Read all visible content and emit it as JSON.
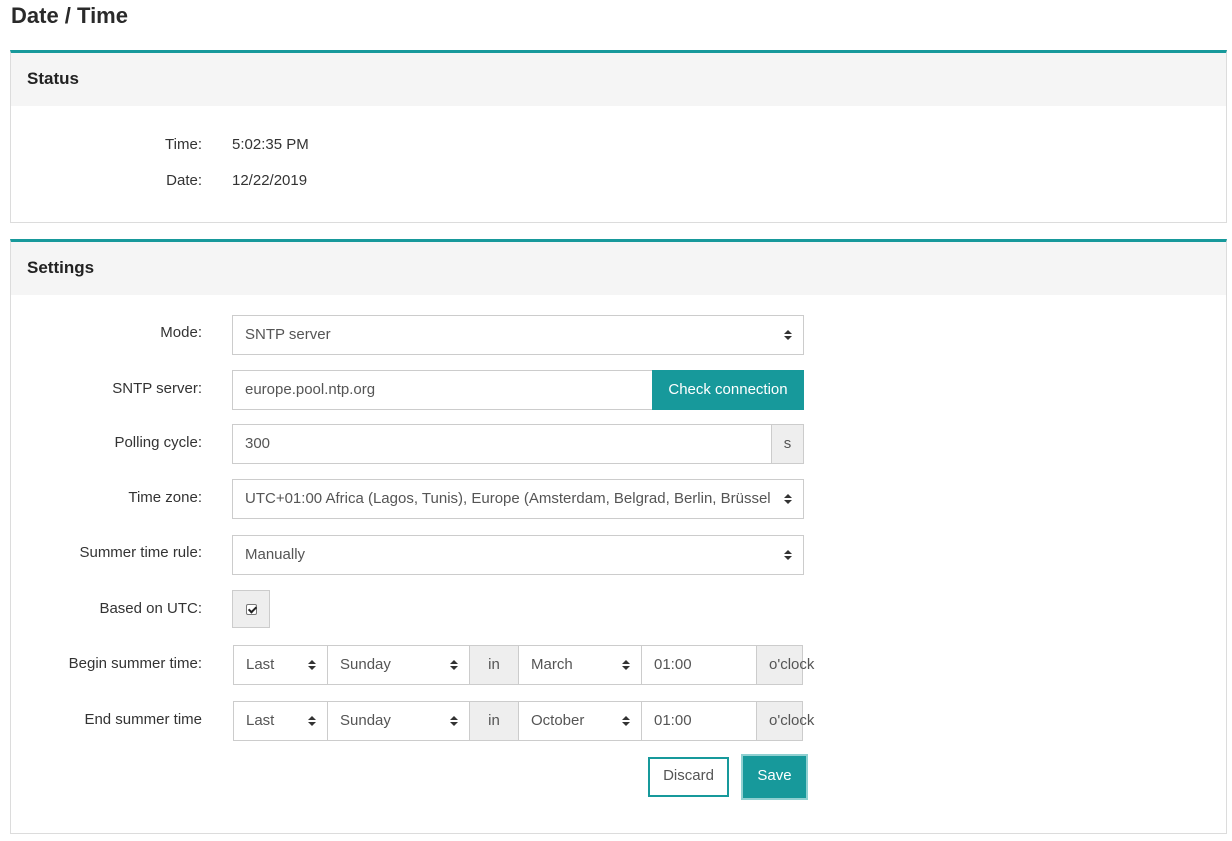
{
  "page": {
    "title": "Date / Time"
  },
  "status": {
    "heading": "Status",
    "time_label": "Time:",
    "time_value": "5:02:35 PM",
    "date_label": "Date:",
    "date_value": "12/22/2019"
  },
  "settings": {
    "heading": "Settings",
    "mode": {
      "label": "Mode:",
      "value": "SNTP server"
    },
    "sntp": {
      "label": "SNTP server:",
      "value": "europe.pool.ntp.org",
      "button": "Check connection"
    },
    "polling": {
      "label": "Polling cycle:",
      "value": "300",
      "unit": "s"
    },
    "timezone": {
      "label": "Time zone:",
      "value": "UTC+01:00 Africa (Lagos, Tunis), Europe (Amsterdam, Belgrad, Berlin, Brüssel"
    },
    "summer_rule": {
      "label": "Summer time rule:",
      "value": "Manually"
    },
    "based_utc": {
      "label": "Based on UTC:",
      "checked": true
    },
    "begin": {
      "label": "Begin summer time:",
      "week": "Last",
      "day": "Sunday",
      "in": "in",
      "month": "March",
      "time": "01:00",
      "suffix": "o'clock"
    },
    "end": {
      "label": "End summer time",
      "week": "Last",
      "day": "Sunday",
      "in": "in",
      "month": "October",
      "time": "01:00",
      "suffix": "o'clock"
    },
    "discard_label": "Discard",
    "save_label": "Save"
  },
  "colors": {
    "accent": "#17999b",
    "panel_head": "#f5f5f5"
  },
  "icons": {
    "select_caret": "sort-caret-icon",
    "checkbox": "checkmark-icon"
  }
}
